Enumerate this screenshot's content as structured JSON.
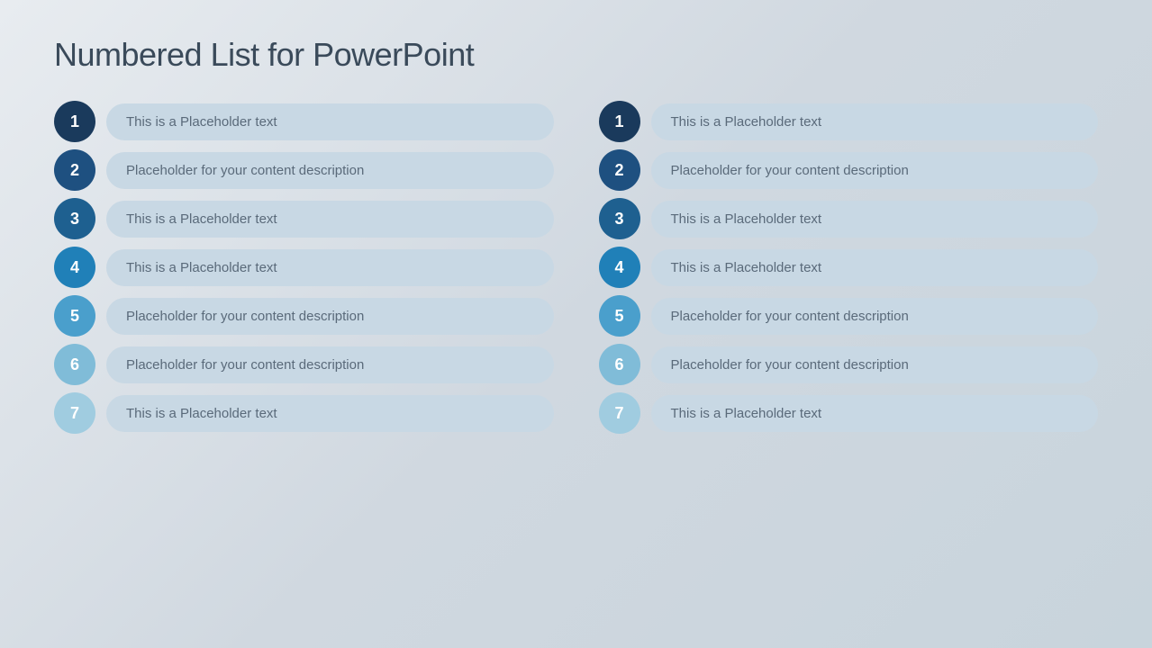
{
  "title": "Numbered List for PowerPoint",
  "left_column": {
    "items": [
      {
        "number": "1",
        "text": "This is a Placeholder text",
        "circle_class": "circle-1"
      },
      {
        "number": "2",
        "text": "Placeholder for your content description",
        "circle_class": "circle-2"
      },
      {
        "number": "3",
        "text": "This is a Placeholder text",
        "circle_class": "circle-3"
      },
      {
        "number": "4",
        "text": "This is a Placeholder text",
        "circle_class": "circle-4"
      },
      {
        "number": "5",
        "text": "Placeholder for your content description",
        "circle_class": "circle-5"
      },
      {
        "number": "6",
        "text": "Placeholder for your content description",
        "circle_class": "circle-6"
      },
      {
        "number": "7",
        "text": "This is a Placeholder text",
        "circle_class": "circle-7"
      }
    ]
  },
  "right_column": {
    "items": [
      {
        "number": "1",
        "text": "This is a Placeholder text",
        "circle_class": "circle-1"
      },
      {
        "number": "2",
        "text": "Placeholder for your content description",
        "circle_class": "circle-2"
      },
      {
        "number": "3",
        "text": "This is a Placeholder text",
        "circle_class": "circle-3"
      },
      {
        "number": "4",
        "text": "This is a Placeholder text",
        "circle_class": "circle-4"
      },
      {
        "number": "5",
        "text": "Placeholder for your content description",
        "circle_class": "circle-5"
      },
      {
        "number": "6",
        "text": "Placeholder for your content description",
        "circle_class": "circle-6"
      },
      {
        "number": "7",
        "text": "This is a Placeholder text",
        "circle_class": "circle-7"
      }
    ]
  }
}
